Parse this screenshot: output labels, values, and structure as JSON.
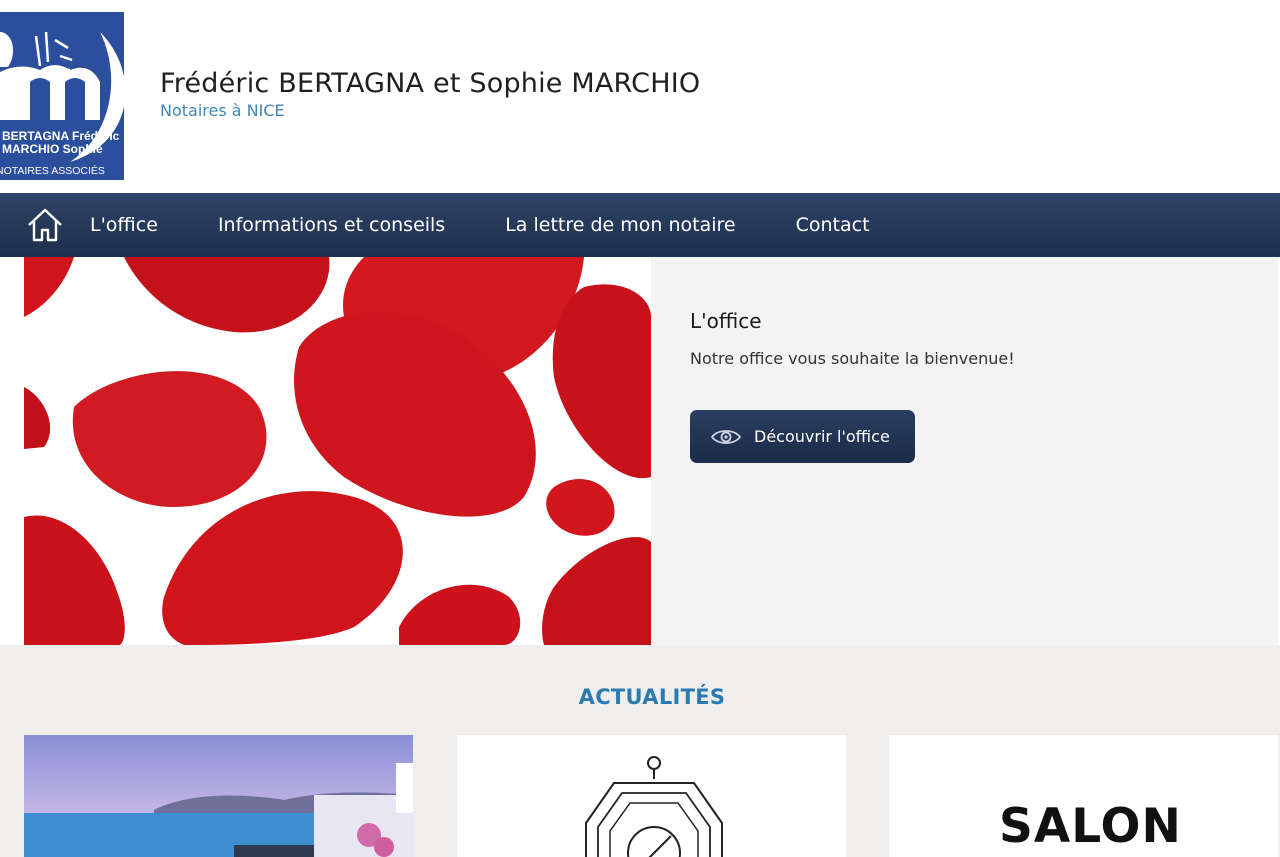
{
  "header": {
    "logo": {
      "text_line1": "BERTAGNA Frédéric",
      "text_line2": "MARCHIO Sophie",
      "text_line3": "NOTAIRES ASSOCIÉS",
      "brand_color": "#2b4f9c"
    },
    "title": "Frédéric BERTAGNA et Sophie MARCHIO",
    "subtitle": "Notaires à NICE"
  },
  "nav": {
    "home_icon": "home-icon",
    "items": [
      {
        "label": "L'office"
      },
      {
        "label": "Informations et conseils"
      },
      {
        "label": "La lettre de mon notaire"
      },
      {
        "label": "Contact"
      }
    ],
    "background": "#243758"
  },
  "hero": {
    "image": "rose-petals-image",
    "heading": "L'office",
    "text": "Notre office vous souhaite la bienvenue!",
    "button": {
      "label": "Découvrir l'office",
      "icon": "eye-icon"
    }
  },
  "news": {
    "title": "ACTUALITÉS",
    "title_color": "#2a7bb0",
    "cards": [
      {
        "image": "santorini-sea-image"
      },
      {
        "image": "compass-lighthouse-drawing"
      },
      {
        "logo_text": "SALON"
      }
    ]
  }
}
